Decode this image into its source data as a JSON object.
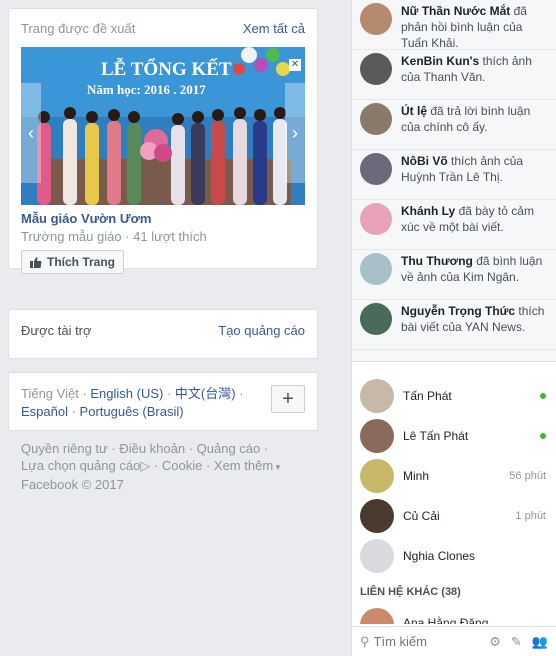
{
  "suggested": {
    "title": "Trang được đề xuất",
    "see_all": "Xem tất cả",
    "photo_banner_line1": "LỄ TỔNG KẾT",
    "photo_banner_line2": "Năm học: 2016 . 2017",
    "page_name": "Mẫu giáo Vườn Ươm",
    "page_meta": "Trường mẫu giáo · 41 lượt thích",
    "like_button": "Thích Trang"
  },
  "sponsored": {
    "title": "Được tài trợ",
    "create_ad": "Tạo quảng cáo"
  },
  "languages": {
    "current": "Tiếng Việt",
    "sep": " · ",
    "items": [
      "English (US)",
      "中文(台灣)",
      "Español",
      "Português (Brasil)"
    ],
    "more_icon": "plus-icon"
  },
  "footer": {
    "privacy": "Quyền riêng tư",
    "terms": "Điều khoản",
    "ads": "Quảng cáo",
    "ad_choices": "Lựa chọn quảng cáo",
    "cookies": "Cookie",
    "more": "Xem thêm",
    "copyright": "Facebook © 2017"
  },
  "ticker": [
    {
      "name": "Nữ Thần Nước Mắt",
      "text": " đã phản hồi bình luận của Tuấn Khải.",
      "color": "#b58a6e"
    },
    {
      "name": "KenBin Kun's",
      "text": " thích ảnh của Thanh Văn.",
      "color": "#5a5a5a"
    },
    {
      "name": "Út lệ",
      "text": " đã trả lời bình luận của chính cô ấy.",
      "color": "#8a7a6a"
    },
    {
      "name": "NôBi Võ",
      "text": " thích ảnh của Huỳnh Trần Lê Thị.",
      "color": "#6a6a7a"
    },
    {
      "name": "Khánh Ly",
      "text": " đã bày tỏ cảm xúc về một bài viết.",
      "color": "#e9a3b8"
    },
    {
      "name": "Thu Thương",
      "text": " đã bình luận về ảnh của Kim Ngân.",
      "color": "#a8c0c8"
    },
    {
      "name": "Nguyễn Trọng Thức",
      "text": " thích bài viết của YAN News.",
      "color": "#4a6a5a"
    }
  ],
  "contacts": [
    {
      "name": "Tấn Phát",
      "status": "",
      "online": true,
      "color": "#c8b8a8"
    },
    {
      "name": "Lê Tấn Phát",
      "status": "",
      "online": true,
      "color": "#8a6a5a"
    },
    {
      "name": "Minh",
      "status": "56 phút",
      "online": false,
      "color": "#c8b86a"
    },
    {
      "name": "Củ Cải",
      "status": "1 phút",
      "online": false,
      "color": "#4a3a30"
    },
    {
      "name": "Nghia Clones",
      "status": "",
      "online": false,
      "color": "#d8dadf"
    }
  ],
  "other_contacts": {
    "title": "LIÊN HỆ KHÁC (38)",
    "partial_name": "Ana Hằng Đặng"
  },
  "chat_search": {
    "placeholder": "Tìm kiếm"
  }
}
